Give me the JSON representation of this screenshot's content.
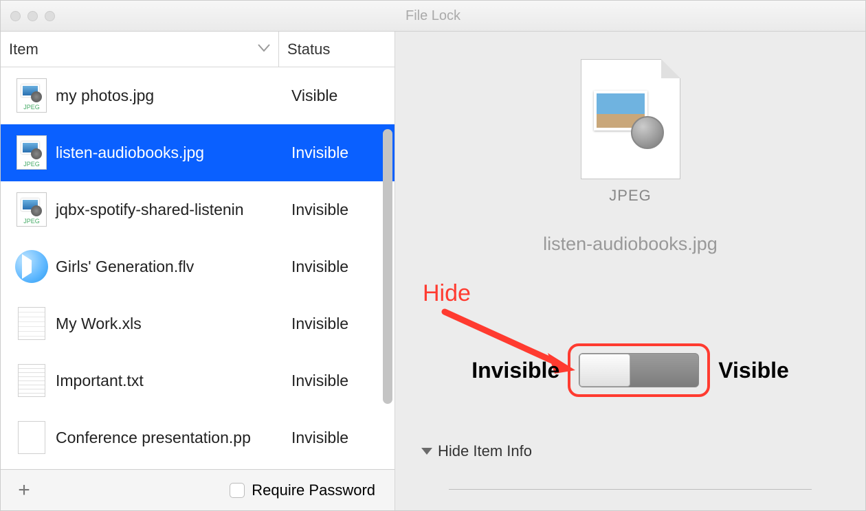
{
  "window": {
    "title": "File Lock"
  },
  "columns": {
    "item": "Item",
    "status": "Status"
  },
  "files": [
    {
      "name": "my photos.jpg",
      "status": "Visible",
      "icon": "jpeg",
      "selected": false
    },
    {
      "name": "listen-audiobooks.jpg",
      "status": "Invisible",
      "icon": "jpeg",
      "selected": true
    },
    {
      "name": "jqbx-spotify-shared-listenin",
      "status": "Invisible",
      "icon": "jpeg",
      "selected": false
    },
    {
      "name": "Girls' Generation.flv",
      "status": "Invisible",
      "icon": "flv",
      "selected": false
    },
    {
      "name": "My Work.xls",
      "status": "Invisible",
      "icon": "xls",
      "selected": false
    },
    {
      "name": "Important.txt",
      "status": "Invisible",
      "icon": "txt",
      "selected": false
    },
    {
      "name": "Conference presentation.pp",
      "status": "Invisible",
      "icon": "pp",
      "selected": false
    }
  ],
  "footer": {
    "add": "+",
    "require_password": "Require Password"
  },
  "preview": {
    "format_label": "JPEG",
    "filename": "listen-audiobooks.jpg",
    "annotation": "Hide",
    "invisible_label": "Invisible",
    "visible_label": "Visible",
    "hide_info": "Hide Item Info"
  }
}
